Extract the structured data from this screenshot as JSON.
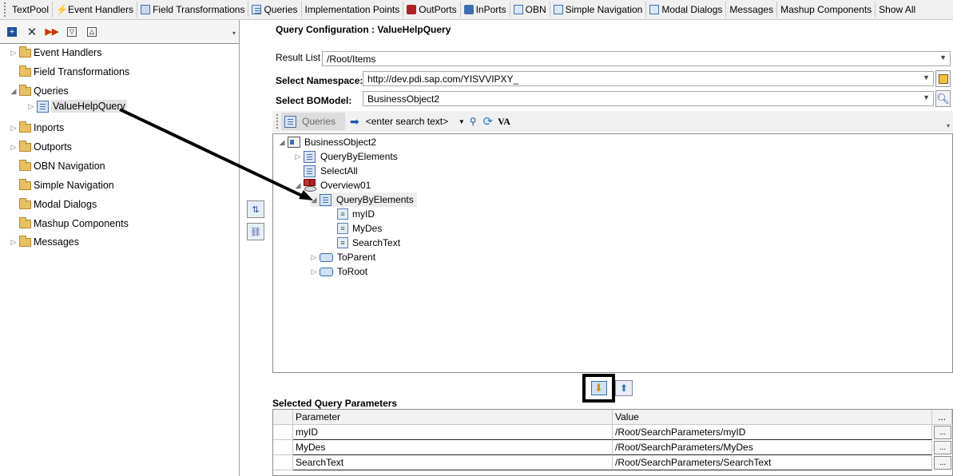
{
  "tabs": [
    {
      "label": "TextPool",
      "icon": "none"
    },
    {
      "label": "Event Handlers",
      "icon": "lightning-icon"
    },
    {
      "label": "Field Transformations",
      "icon": "transform-icon"
    },
    {
      "label": "Queries",
      "icon": "query-icon"
    },
    {
      "label": "Implementation Points",
      "icon": "none"
    },
    {
      "label": "OutPorts",
      "icon": "outport-icon"
    },
    {
      "label": "InPorts",
      "icon": "inport-icon"
    },
    {
      "label": "OBN",
      "icon": "obn-icon"
    },
    {
      "label": "Simple Navigation",
      "icon": "navigation-icon"
    },
    {
      "label": "Modal Dialogs",
      "icon": "dialog-icon"
    },
    {
      "label": "Messages",
      "icon": "none"
    },
    {
      "label": "Mashup Components",
      "icon": "none"
    },
    {
      "label": "Show All",
      "icon": "none"
    }
  ],
  "left_tree": {
    "items": [
      {
        "label": "Event Handlers",
        "expander": "▷"
      },
      {
        "label": "Field Transformations",
        "expander": ""
      },
      {
        "label": "Queries",
        "expander": "◢"
      },
      {
        "label": "ValueHelpQuery",
        "expander": "▷"
      },
      {
        "label": "Inports",
        "expander": "▷"
      },
      {
        "label": "Outports",
        "expander": "▷"
      },
      {
        "label": "OBN Navigation",
        "expander": ""
      },
      {
        "label": "Simple Navigation",
        "expander": ""
      },
      {
        "label": "Modal Dialogs",
        "expander": ""
      },
      {
        "label": "Mashup Components",
        "expander": ""
      },
      {
        "label": "Messages",
        "expander": "▷"
      }
    ]
  },
  "config": {
    "title": "Query Configuration : ValueHelpQuery",
    "result_list_label": "Result List",
    "result_list_value": "/Root/Items",
    "namespace_label": "Select Namespace:",
    "namespace_value": "http://dev.pdi.sap.com/YISVVIPXY_",
    "bomodel_label": "Select BOModel:",
    "bomodel_value": "BusinessObject2"
  },
  "query_toolbar": {
    "queries_label": "Queries",
    "search_placeholder": "<enter search text>",
    "va_label": "VA"
  },
  "bo_tree": {
    "root": "BusinessObject2",
    "nodes": [
      {
        "label": "QueryByElements",
        "expander": "▷"
      },
      {
        "label": "SelectAll",
        "expander": ""
      },
      {
        "label": "Overview01",
        "expander": "◢"
      },
      {
        "label": "QueryByElements",
        "expander": "◢"
      },
      {
        "label": "myID",
        "expander": ""
      },
      {
        "label": "MyDes",
        "expander": ""
      },
      {
        "label": "SearchText",
        "expander": ""
      },
      {
        "label": "ToParent",
        "expander": "▷"
      },
      {
        "label": "ToRoot",
        "expander": "▷"
      }
    ]
  },
  "selected_params": {
    "title": "Selected Query Parameters",
    "col_parameter": "Parameter",
    "col_value": "Value",
    "col_more": "...",
    "rows": [
      {
        "parameter": "myID",
        "value": "/Root/SearchParameters/myID",
        "btn": "..."
      },
      {
        "parameter": "MyDes",
        "value": "/Root/SearchParameters/MyDes",
        "btn": "..."
      },
      {
        "parameter": "SearchText",
        "value": "/Root/SearchParameters/SearchText",
        "btn": "..."
      }
    ]
  }
}
